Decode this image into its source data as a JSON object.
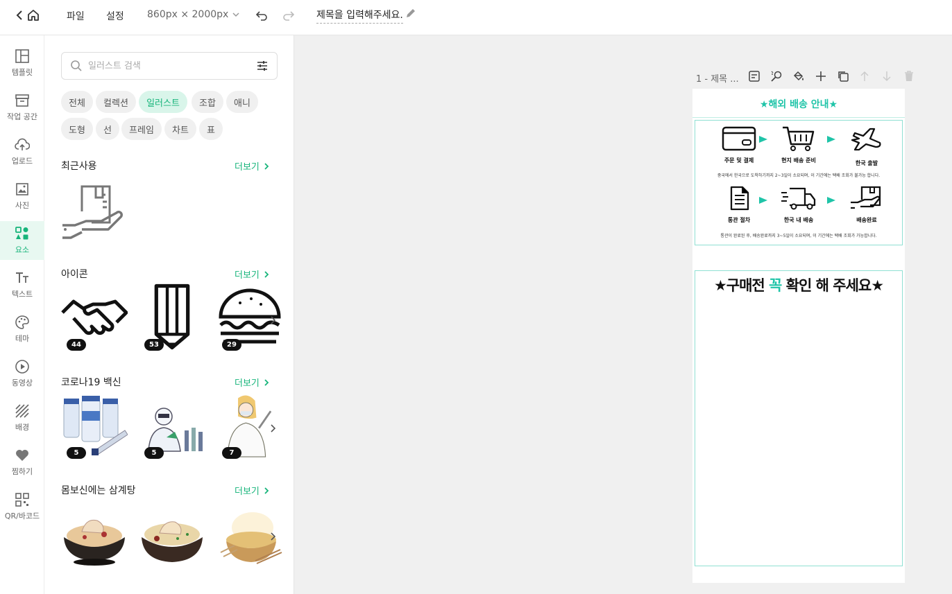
{
  "topbar": {
    "menu_file": "파일",
    "menu_settings": "설정",
    "canvas_size": "860px × 2000px",
    "doc_title": "제목을 입력해주세요."
  },
  "rail": {
    "items": [
      {
        "label": "템플릿",
        "icon": "template-icon"
      },
      {
        "label": "작업 공간",
        "icon": "archive-icon"
      },
      {
        "label": "업로드",
        "icon": "upload-icon"
      },
      {
        "label": "사진",
        "icon": "photo-icon"
      },
      {
        "label": "요소",
        "icon": "elements-icon",
        "active": true
      },
      {
        "label": "텍스트",
        "icon": "text-icon"
      },
      {
        "label": "테마",
        "icon": "palette-icon"
      },
      {
        "label": "동영상",
        "icon": "play-icon"
      },
      {
        "label": "배경",
        "icon": "background-icon"
      },
      {
        "label": "찜하기",
        "icon": "heart-icon"
      },
      {
        "label": "QR/바코드",
        "icon": "qr-icon"
      }
    ]
  },
  "panel": {
    "search_placeholder": "일러스트 검색",
    "chips": [
      "전체",
      "컬렉션",
      "일러스트",
      "조합",
      "애니",
      "도형",
      "선",
      "프레임",
      "차트",
      "표"
    ],
    "active_chip": "일러스트",
    "more_label": "더보기",
    "sections": [
      {
        "title": "최근사용"
      },
      {
        "title": "아이콘",
        "counts": [
          "44",
          "53",
          "29"
        ]
      },
      {
        "title": "코로나19 백신",
        "counts": [
          "5",
          "5",
          "7"
        ]
      },
      {
        "title": "몸보신에는 삼계탕"
      }
    ]
  },
  "canvas": {
    "page_label": "1 - 제목 ...",
    "banner_title": "★해외 배송 안내★",
    "steps_row1": [
      "주문 및 결제",
      "현지 배송 준비",
      "한국 출발"
    ],
    "note1": "중국에서 한국으로 도착하기까지 2~3일이 소요되며, 이 기간에는 택배 조회가 불가능 합니다.",
    "steps_row2": [
      "통관 절차",
      "한국 내 배송",
      "배송완료"
    ],
    "note2": "통관이 완료된 후, 배송완료까지 3~5일이 소요되며, 이 기간에는 택배 조회가 가능합니다.",
    "headline_pre": "★구매전 ",
    "headline_accent": "꼭",
    "headline_post": " 확인 해 주세요★"
  },
  "colors": {
    "accent": "#16b47a",
    "teal": "#1fc4a8"
  }
}
